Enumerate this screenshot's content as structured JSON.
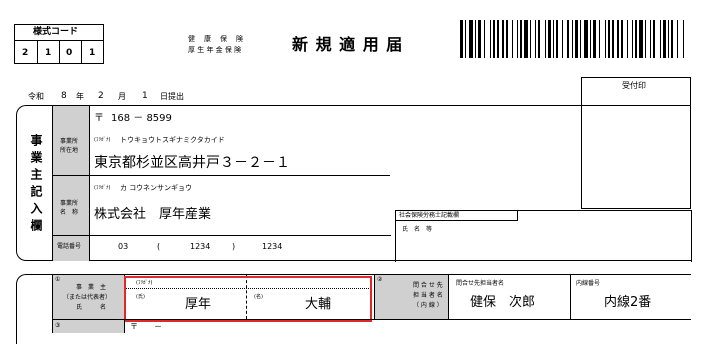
{
  "form_code": {
    "label": "様式コード",
    "digits": [
      "2",
      "1",
      "0",
      "1"
    ]
  },
  "title": {
    "small_line1": "健　康　保　険",
    "small_line2": "厚 生 年 金 保 険",
    "main": "新 規 適 用 届"
  },
  "stamp": {
    "label": "受付印"
  },
  "date": {
    "era": "令和",
    "year": "8",
    "year_unit": "年",
    "month": "2",
    "month_unit": "月",
    "day": "1",
    "submit": "日提出"
  },
  "side_label": "事業主記入欄",
  "office": {
    "postal_mark": "〒",
    "postal": "168 － 8599",
    "address_label": "事業所\n所在地",
    "furigana_tag": "(ﾌﾘｶﾞﾅ)",
    "address_kana": "トウキョウトスギナミクタカイド",
    "address": "東京都杉並区高井戸３－２－１",
    "name_label": "事業所\n名　称",
    "name_kana": "カ コウネンサンギョウ",
    "name": "株式会社　厚年産業",
    "phone_label": "電話番号",
    "phone_1": "03",
    "phone_paren_open": "(",
    "phone_2": "1234",
    "phone_paren_close": ")",
    "phone_3": "1234"
  },
  "sharoshi": {
    "header": "社会保険労務士記載欄",
    "name_label": "氏　名　等"
  },
  "owner": {
    "circled_num": "①",
    "label_line1": "事　業　主",
    "label_line2": "（または代表者）",
    "label_line3": "氏　　　名",
    "furigana_tag": "(ﾌﾘｶﾞﾅ)",
    "surname_tag": "(氏)",
    "given_tag": "(名)",
    "surname": "厚年",
    "given": "大輔",
    "inquiry_num": "②",
    "inquiry_label": "問 合 せ 先\n担 当 者 名\n（ 内 線 ）",
    "contact_label": "問合せ先担当者名",
    "contact_name": "健保　次郎",
    "ext_label": "内線番号",
    "ext_value": "内線2番",
    "row2_num": "③",
    "row2_postal": "〒　　－"
  }
}
